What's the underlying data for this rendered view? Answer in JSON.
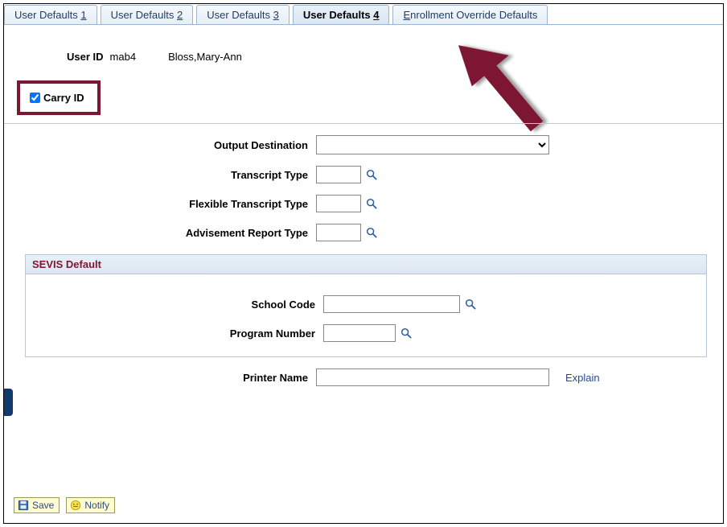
{
  "tabs": [
    {
      "prefix": "User Defaults ",
      "accel": "1"
    },
    {
      "prefix": "User Defaults ",
      "accel": "2"
    },
    {
      "prefix": "User Defaults ",
      "accel": "3"
    },
    {
      "prefix": "User Defaults ",
      "accel": "4"
    },
    {
      "prefix": "",
      "accel": "E",
      "suffix": "nrollment Override Defaults"
    }
  ],
  "active_tab_index": 3,
  "user": {
    "label": "User ID",
    "id": "mab4",
    "name": "Bloss,Mary-Ann"
  },
  "carry_id": {
    "label": "Carry ID",
    "checked": true
  },
  "fields": {
    "output_destination": {
      "label": "Output Destination",
      "value": ""
    },
    "transcript_type": {
      "label": "Transcript Type",
      "value": ""
    },
    "flexible_transcript_type": {
      "label": "Flexible Transcript Type",
      "value": ""
    },
    "advisement_report_type": {
      "label": "Advisement Report Type",
      "value": ""
    },
    "printer_name": {
      "label": "Printer Name",
      "value": ""
    }
  },
  "sevis": {
    "section_title": "SEVIS Default",
    "school_code": {
      "label": "School Code",
      "value": ""
    },
    "program_number": {
      "label": "Program Number",
      "value": ""
    }
  },
  "explain_link": "Explain",
  "buttons": {
    "save": "Save",
    "notify": "Notify"
  }
}
